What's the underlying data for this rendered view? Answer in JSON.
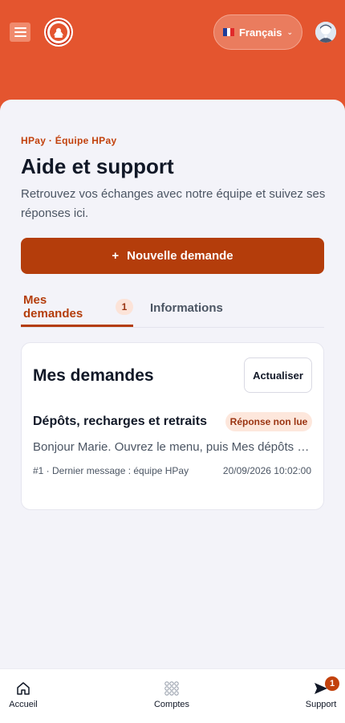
{
  "header": {
    "language_label": "Français",
    "icons": {
      "menu": "hamburger-menu-icon",
      "logo": "brand-logo",
      "flag": "french-flag-icon",
      "chevron": "chevron-down-icon",
      "avatar": "user-avatar"
    }
  },
  "page": {
    "eyebrow": "HPay · Équipe HPay",
    "title": "Aide et support",
    "description": "Retrouvez vos échanges avec notre équipe et suivez ses réponses ici.",
    "new_request_label": "Nouvelle demande",
    "new_request_icon": "+"
  },
  "tabs": [
    {
      "label": "Mes demandes",
      "badge": "1",
      "active": true
    },
    {
      "label": "Informations",
      "active": false
    }
  ],
  "requests_panel": {
    "title": "Mes demandes",
    "refresh_label": "Actualiser",
    "items": [
      {
        "title": "Dépôts, recharges et retraits",
        "status": "Réponse non lue",
        "preview": "Bonjour Marie. Ouvrez le menu, puis Mes dépôts puis Nouveau dépôt.",
        "meta": "#1 · Dernier message : équipe HPay",
        "date": "20/09/2026 10:02:00"
      }
    ]
  },
  "bottom_nav": [
    {
      "label": "Accueil",
      "icon": "home-icon"
    },
    {
      "label": "Comptes",
      "icon": "grid-dots-icon"
    },
    {
      "label": "Support",
      "icon": "send-icon",
      "badge": "1"
    }
  ],
  "colors": {
    "header_bg": "#e4552f",
    "accent": "#b43d0b",
    "background": "#f3f3f9",
    "status_bg": "#fde7dc"
  }
}
